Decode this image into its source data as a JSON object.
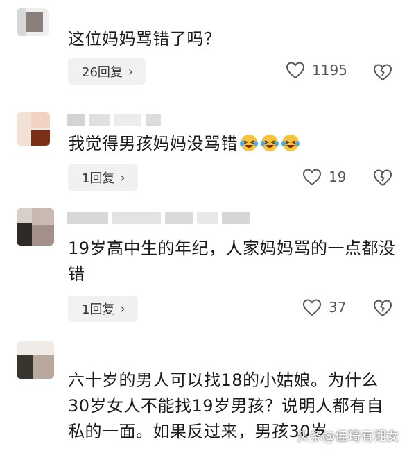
{
  "comments": [
    {
      "text": "这位妈妈骂错了吗？",
      "reply_label": "26回复",
      "likes": "1195"
    },
    {
      "text": "我觉得男孩妈妈没骂错",
      "emojis": [
        "laughing-crying-emoji",
        "laughing-crying-emoji",
        "laughing-crying-emoji"
      ],
      "reply_label": "1回复",
      "likes": "19"
    },
    {
      "text": "19岁高中生的年纪，人家妈妈骂的一点都没错",
      "reply_label": "1回复",
      "likes": "37"
    },
    {
      "text": "六十岁的男人可以找18的小姑娘。为什么30岁女人不能找19岁男孩？说明人都有自私的一面。如果反过来，男孩30岁"
    }
  ],
  "icons": {
    "like": "heart-outline-icon",
    "dislike": "broken-heart-icon",
    "chevron": "chevron-right-icon"
  },
  "watermark": "头条@佳琦有湘女",
  "colors": {
    "background": "#ffffff",
    "text": "#1a1a1a",
    "reply_bg": "#f1f1f1",
    "icon": "#555555"
  }
}
